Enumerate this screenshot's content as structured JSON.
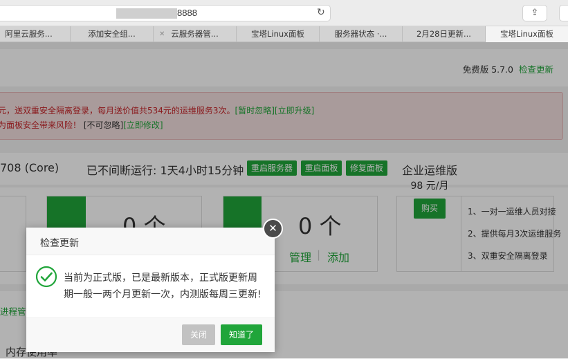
{
  "browser": {
    "url_visible": "8888",
    "tabs": [
      "阿里云服务...",
      "添加安全组...",
      "云服务器管...",
      "宝塔Linux面板",
      "服务器状态 ·...",
      "2月28日更新...",
      "宝塔Linux面板"
    ]
  },
  "header": {
    "version": "免费版 5.7.0",
    "check_update": "检查更新"
  },
  "alert": {
    "line1": "元，送双重安全隔离登录，每月送价值共534元的运维服务3次。",
    "line1_ignore": "[暂时忽略]",
    "line1_upgrade": "[立即升级]",
    "line2": "为面板安全带来风险！",
    "line2_ignore": "[不可忽略]",
    "line2_modify": "[立即修改]"
  },
  "status": {
    "os": "708 (Core)",
    "uptime": "已不间断运行: 1天4小时15分钟",
    "restart_server": "重启服务器",
    "restart_panel": "重启面板",
    "repair_panel": "修复面板"
  },
  "cards": {
    "count1": "0 个",
    "count2": "0 个",
    "manage": "管理",
    "separator": "|",
    "add": "添加"
  },
  "enterprise": {
    "title": "企业运维版",
    "price": "98 元/月",
    "buy": "购买",
    "features": [
      "1、一对一运维人员对接",
      "2、提供每月3次运维服务",
      "3、双重安全隔离登录"
    ]
  },
  "lower": {
    "process": "进程管",
    "memory": "内存使用率"
  },
  "dialog": {
    "title": "检查更新",
    "message": "当前为正式版，已是最新版本，正式版更新周期一般一两个月更新一次，内测版每周三更新!",
    "close": "关闭",
    "ok": "知道了"
  },
  "colors": {
    "accent": "#20a53a",
    "alert_text": "#c6272c",
    "alert_bg": "#f3dede"
  }
}
